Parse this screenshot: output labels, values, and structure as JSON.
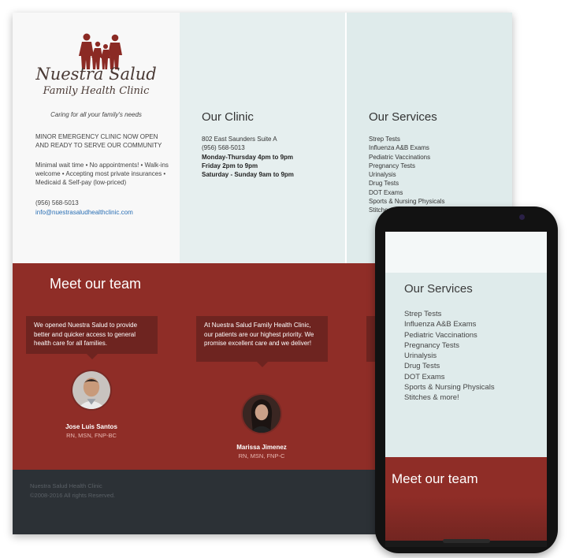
{
  "logo": {
    "name": "Nuestra Salud",
    "subtitle": "Family Health Clinic",
    "colors": {
      "brand": "#8b2a24"
    }
  },
  "intro": {
    "tagline": "Caring for all your family's needs",
    "announcement": "MINOR EMERGENCY CLINIC NOW OPEN AND READY TO SERVE OUR COMMUNITY",
    "features": "Minimal wait time • No appointments! • Walk-ins welcome • Accepting most private insurances • Medicaid & Self-pay (low-priced)",
    "phone": "(956) 568-5013",
    "email": "info@nuestrasaludhealthclinic.com"
  },
  "clinic": {
    "title": "Our Clinic",
    "address": "802 East Saunders Suite A",
    "phone": "(956) 568-5013",
    "hours": [
      "Monday-Thursday 4pm to 9pm",
      "Friday 2pm to 9pm",
      "Saturday - Sunday 9am to 9pm"
    ]
  },
  "services": {
    "title": "Our Services",
    "items": [
      "Strep Tests",
      "Influenza A&B Exams",
      "Pediatric Vaccinations",
      "Pregnancy Tests",
      "Urinalysis",
      "Drug Tests",
      "DOT Exams",
      "Sports & Nursing Physicals",
      "Stitches & more!"
    ]
  },
  "team": {
    "title": "Meet our team",
    "members": [
      {
        "quote": "We opened Nuestra Salud to provide better and quicker access to general health care for all families.",
        "name": "Jose Luis Santos",
        "credentials": "RN, MSN, FNP-BC"
      },
      {
        "quote": "At Nuestra Salud Family Health Clinic, our patients are our highest priority. We promise excellent care and we deliver!",
        "name": "Marissa Jimenez",
        "credentials": "RN, MSN, FNP-C"
      }
    ]
  },
  "footer": {
    "name": "Nuestra Salud Health Clinic",
    "copyright": "©2008-2016 All rights Reserved."
  },
  "phone_view": {
    "services_title": "Our Services",
    "team_title": "Meet our team"
  }
}
